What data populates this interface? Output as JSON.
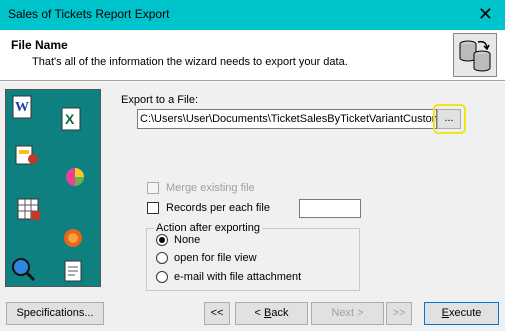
{
  "window": {
    "title": "Sales of Tickets Report Export",
    "close_glyph": "✕"
  },
  "header": {
    "title": "File Name",
    "subtitle": "That's all of the information the wizard needs to export your data.",
    "icon": "database-sync-icon"
  },
  "sidebar": {
    "icons": [
      "word-document-icon",
      "excel-icon",
      "report-icon",
      "chart-icon",
      "spreadsheet-icon",
      "firefox-icon",
      "search-globe-icon",
      "notepad-icon"
    ]
  },
  "export": {
    "label": "Export to a File:",
    "path": "C:\\Users\\User\\Documents\\TicketSalesByTicketVariantCustomer",
    "browse_label": "..."
  },
  "options": {
    "merge_label": "Merge existing file",
    "merge_enabled": false,
    "records_label": "Records per each file",
    "records_value": ""
  },
  "action_group": {
    "title": "Action after exporting",
    "options": [
      {
        "label": "None",
        "selected": true
      },
      {
        "label": "open for file view",
        "selected": false
      },
      {
        "label": "e-mail with file attachment",
        "selected": false
      }
    ]
  },
  "buttons": {
    "specifications": "Specifications...",
    "first": "<<",
    "back_prefix": "< ",
    "back_accel": "B",
    "back_rest": "ack",
    "next": "Next >",
    "last": ">>",
    "execute_accel": "E",
    "execute_rest": "xecute"
  },
  "colors": {
    "titlebar": "#00c4cc",
    "sidebar": "#0f8080",
    "highlight": "#f0e41e"
  }
}
